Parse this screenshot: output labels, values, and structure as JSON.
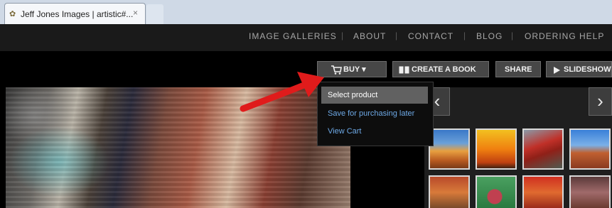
{
  "browser": {
    "tab_title": "Jeff Jones Images | artistic#...",
    "tab_close": "×"
  },
  "nav": {
    "items": [
      "IMAGE GALLERIES",
      "ABOUT",
      "CONTACT",
      "BLOG",
      "ORDERING HELP"
    ],
    "separator": "|"
  },
  "actions": {
    "buy": "BUY ▾",
    "create_book": "CREATE A BOOK",
    "share": "SHARE",
    "slideshow": "SLIDESHOW"
  },
  "dropdown": {
    "items": [
      "Select product",
      "Save for purchasing later",
      "View Cart"
    ],
    "selected_index": 0
  },
  "thumbs_nav": {
    "prev": "‹",
    "next": "›"
  },
  "colors": {
    "page_bg": "#000000",
    "nav_bg": "#1a1a1a",
    "nav_text": "#a7a7a7",
    "button_bg": "#474747",
    "dropdown_bg": "#0d0d0d",
    "dropdown_selected_bg": "#616161",
    "dropdown_link": "#6ea9e6",
    "annotation_arrow": "#e01b1b"
  },
  "icons": {
    "buy": "cart-icon",
    "book": "book-icon",
    "slideshow": "play-icon",
    "favicon": "site-favicon-icon"
  }
}
